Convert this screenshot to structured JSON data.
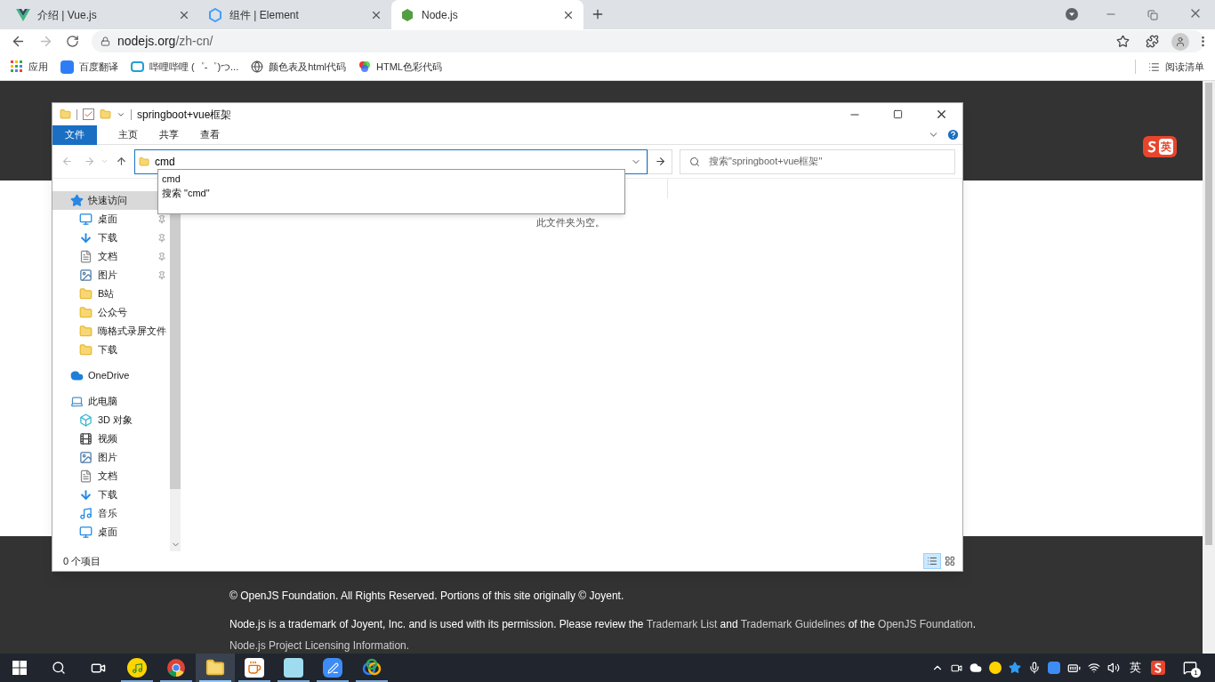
{
  "browser": {
    "tabs": [
      {
        "title": "介绍 | Vue.js",
        "kind": "vue",
        "selected": false
      },
      {
        "title": "组件 | Element",
        "kind": "element",
        "selected": false
      },
      {
        "title": "Node.js",
        "kind": "node",
        "selected": true
      }
    ],
    "url": {
      "host": "nodejs.org",
      "path": "/zh-cn/"
    },
    "bookmarks": [
      {
        "label": "应用",
        "kind": "apps"
      },
      {
        "label": "百度翻译",
        "kind": "translate"
      },
      {
        "label": "哔哩哔哩 (゜-゜)つ...",
        "kind": "tv"
      },
      {
        "label": "颜色表及html代码",
        "kind": "globe"
      },
      {
        "label": "HTML色彩代码",
        "kind": "color"
      }
    ],
    "reading_list": "阅读清单"
  },
  "explorer": {
    "title": "springboot+vue框架",
    "ribbon_tabs": [
      {
        "label": "文件",
        "selected": true
      },
      {
        "label": "主页",
        "selected": false
      },
      {
        "label": "共享",
        "selected": false
      },
      {
        "label": "查看",
        "selected": false
      }
    ],
    "address": "cmd",
    "suggestions": [
      "cmd",
      "搜索 \"cmd\""
    ],
    "search_placeholder": "搜索\"springboot+vue框架\"",
    "nav": [
      {
        "label": "快速访问",
        "kind": "star",
        "selected": true,
        "children": [
          {
            "label": "桌面",
            "kind": "desktop",
            "pinned": true
          },
          {
            "label": "下载",
            "kind": "download",
            "pinned": true
          },
          {
            "label": "文档",
            "kind": "document",
            "pinned": true
          },
          {
            "label": "图片",
            "kind": "pictures",
            "pinned": true
          },
          {
            "label": "B站",
            "kind": "folder",
            "pinned": false
          },
          {
            "label": "公众号",
            "kind": "folder",
            "pinned": false
          },
          {
            "label": "嗨格式录屏文件",
            "kind": "folder",
            "pinned": false
          },
          {
            "label": "下载",
            "kind": "folder",
            "pinned": false
          }
        ]
      },
      {
        "label": "OneDrive",
        "kind": "cloud",
        "selected": false
      },
      {
        "label": "此电脑",
        "kind": "computer",
        "selected": false,
        "children": [
          {
            "label": "3D 对象",
            "kind": "cube",
            "pinned": false
          },
          {
            "label": "视频",
            "kind": "video",
            "pinned": false
          },
          {
            "label": "图片",
            "kind": "pictures",
            "pinned": false
          },
          {
            "label": "文档",
            "kind": "document",
            "pinned": false
          },
          {
            "label": "下载",
            "kind": "download",
            "pinned": false
          },
          {
            "label": "音乐",
            "kind": "music",
            "pinned": false
          },
          {
            "label": "桌面",
            "kind": "desktop",
            "pinned": false
          }
        ]
      }
    ],
    "empty_message": "此文件夹为空。",
    "status": "0 个项目",
    "view_buttons": [
      {
        "kind": "details",
        "selected": true
      },
      {
        "kind": "tiles",
        "selected": false
      }
    ]
  },
  "ime_badge": "英",
  "footer": {
    "copyright": "© OpenJS Foundation. All Rights Reserved. Portions of this site originally © Joyent.",
    "trademark": [
      {
        "text": "Node.js is a trademark of Joyent, Inc. and is used with its permission. Please review the ",
        "kind": "text"
      },
      {
        "text": "Trademark List",
        "kind": "link"
      },
      {
        "text": " and ",
        "kind": "text"
      },
      {
        "text": "Trademark Guidelines",
        "kind": "link"
      },
      {
        "text": " of the ",
        "kind": "text"
      },
      {
        "text": "OpenJS Foundation",
        "kind": "link"
      },
      {
        "text": ".",
        "kind": "text"
      }
    ],
    "licensing": "Node.js Project Licensing Information."
  },
  "taskbar": {
    "apps": [
      {
        "kind": "music",
        "running": true,
        "selected": false
      },
      {
        "kind": "chrome",
        "running": true,
        "selected": false
      },
      {
        "kind": "explorer",
        "running": true,
        "selected": true
      },
      {
        "kind": "java",
        "running": true,
        "selected": false
      },
      {
        "kind": "anime",
        "running": true,
        "selected": false
      },
      {
        "kind": "pen",
        "running": true,
        "selected": false
      },
      {
        "kind": "rings",
        "running": true,
        "selected": false
      }
    ],
    "ime": "英",
    "notifications": "1"
  }
}
